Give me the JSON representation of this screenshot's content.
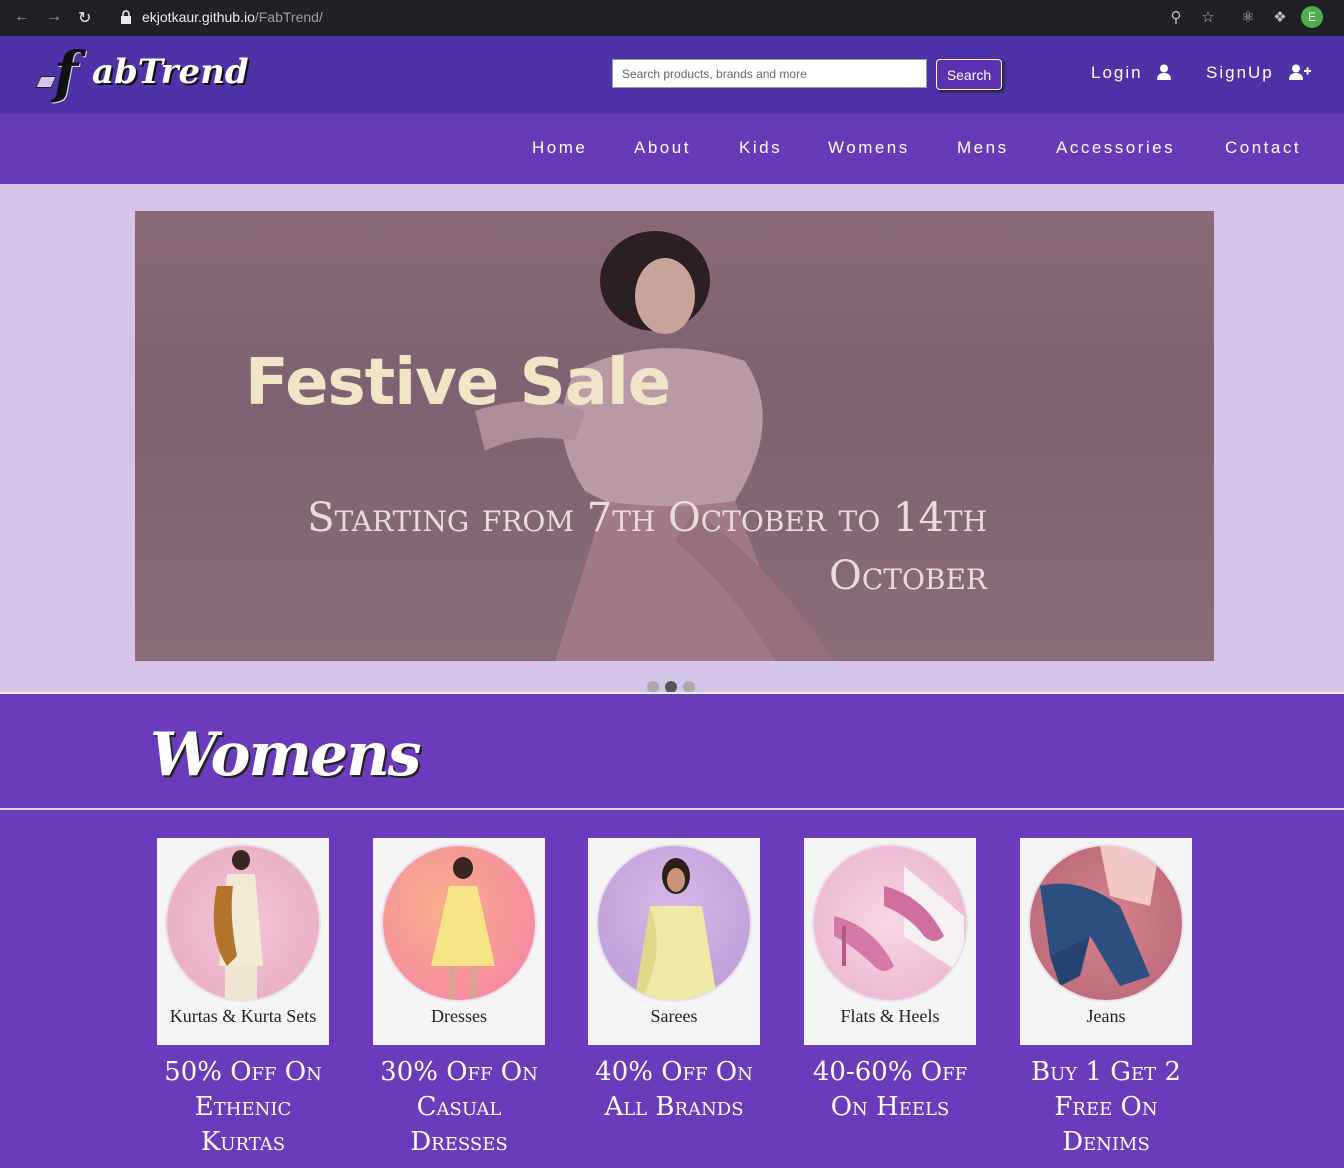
{
  "browser": {
    "url_host": "ekjotkaur.github.io",
    "url_path": "/FabTrend/",
    "profile_initial": "E"
  },
  "header": {
    "logo_letter": "f",
    "logo_text": "abTrend",
    "search_placeholder": "Search products, brands and more",
    "search_label": "Search",
    "login_label": "Login",
    "signup_label": "SignUp"
  },
  "nav": {
    "items": [
      "Home",
      "About",
      "Kids",
      "Womens",
      "Mens",
      "Accessories",
      "Contact"
    ]
  },
  "carousel": {
    "title": "Festive Sale",
    "subtitle": "Starting from 7th October to 14th October",
    "slide_count": 3,
    "active_index": 1
  },
  "womens": {
    "title": "Womens",
    "cards": [
      {
        "label": "Kurtas & Kurta Sets",
        "offer": "50% Off On Ethenic Kurtas"
      },
      {
        "label": "Dresses",
        "offer": "30% Off On Casual Dresses"
      },
      {
        "label": "Sarees",
        "offer": "40% Off On All Brands"
      },
      {
        "label": "Flats & Heels",
        "offer": "40-60% Off On Heels"
      },
      {
        "label": "Jeans",
        "offer": "Buy 1 Get 2 Free On Denims"
      }
    ]
  },
  "colors": {
    "header_bg": "#5032a8",
    "nav_bg": "#673ab7",
    "section_bg": "#6a3bbb",
    "carousel_bg": "#d3c4e8"
  }
}
